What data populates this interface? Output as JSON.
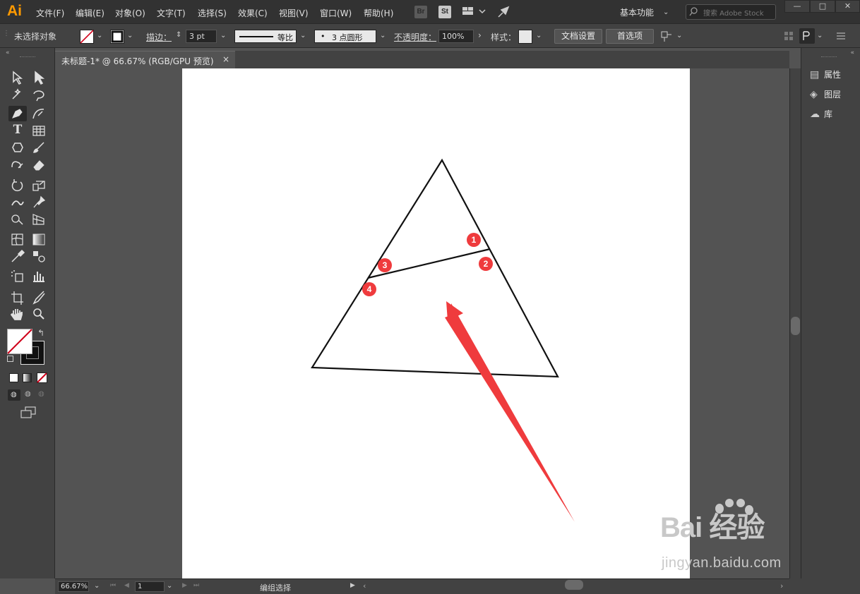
{
  "app": {
    "logo": "Ai"
  },
  "menu": [
    "文件(F)",
    "编辑(E)",
    "对象(O)",
    "文字(T)",
    "选择(S)",
    "效果(C)",
    "视图(V)",
    "窗口(W)",
    "帮助(H)"
  ],
  "menubar": {
    "bridge_label": "Br",
    "stock_label": "St",
    "workspace": "基本功能",
    "search_placeholder": "搜索 Adobe Stock",
    "win_min": "—",
    "win_max": "□",
    "win_close": "✕"
  },
  "control_bar": {
    "selection_status": "未选择对象",
    "stroke_label": "描边：",
    "stroke_weight": "3 pt",
    "stroke_profile": "等比",
    "brush": "3 点圆形",
    "brush_dot": "•",
    "opacity_label": "不透明度：",
    "opacity_value": "100%",
    "style_label": "样式：",
    "doc_setup_button": "文档设置",
    "preferences_button": "首选项"
  },
  "tab": {
    "title": "未标题-1* @ 66.67% (RGB/GPU 预览)",
    "close": "×"
  },
  "right_panel": [
    {
      "icon": "properties-icon",
      "label": "属性"
    },
    {
      "icon": "layers-icon",
      "label": "图层"
    },
    {
      "icon": "libraries-icon",
      "label": "库"
    }
  ],
  "status_bar": {
    "zoom": "66.67%",
    "artboard_number": "1",
    "tool_status": "编组选择"
  },
  "canvas_labels": [
    "1",
    "2",
    "3",
    "4"
  ],
  "colors": {
    "accent_red": "#ef3b3d",
    "fill_none_red": "#d0021b",
    "logo_orange": "#ff9a00"
  },
  "watermark": {
    "brand": "Bai 经验",
    "url": "jingyan.baidu.com"
  }
}
